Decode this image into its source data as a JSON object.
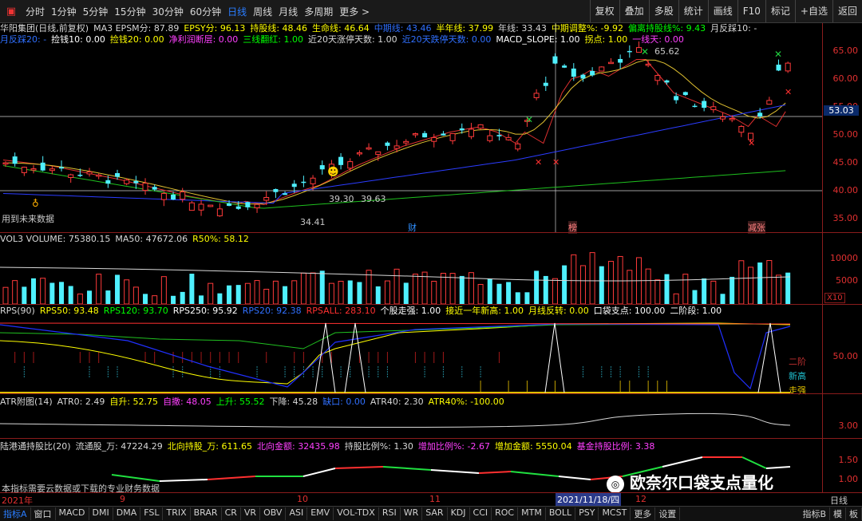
{
  "topbar": {
    "periods": [
      "分时",
      "1分钟",
      "5分钟",
      "15分钟",
      "30分钟",
      "60分钟",
      "日线",
      "周线",
      "月线",
      "多周期",
      "更多 >"
    ],
    "active_index": 6,
    "right_buttons": [
      "复权",
      "叠加",
      "多股",
      "统计",
      "画线",
      "F10",
      "标记",
      "+自选",
      "返回"
    ]
  },
  "main_info": {
    "row1": [
      {
        "t": "华阳集团(日线,前复权)",
        "c": "#d8d8d8"
      },
      {
        "t": "MA3 EPSM分: 87.89",
        "c": "#d8d8d8"
      },
      {
        "t": "EPSY分: 96.13",
        "c": "#ffff00"
      },
      {
        "t": "持股线: 48.46",
        "c": "#ffff00"
      },
      {
        "t": "生命线: 46.64",
        "c": "#ffff00"
      },
      {
        "t": "中期线: 43.46",
        "c": "#3070ff"
      },
      {
        "t": "半年线: 37.99",
        "c": "#ffff00"
      },
      {
        "t": "年线: 33.43",
        "c": "#d8d8d8"
      },
      {
        "t": "中期调整%: -9.92",
        "c": "#ffff00"
      },
      {
        "t": "偏离持股线%: 9.43",
        "c": "#00ff00"
      },
      {
        "t": "月反踩10: -",
        "c": "#d8d8d8"
      }
    ],
    "row2": [
      {
        "t": "月反踩20: -",
        "c": "#3070ff"
      },
      {
        "t": "捡钱10: 0.00",
        "c": "#ffffff"
      },
      {
        "t": "捡钱20: 0.00",
        "c": "#ffff00"
      },
      {
        "t": "净利润断层: 0.00",
        "c": "#ff40ff"
      },
      {
        "t": "三线翻红: 1.00",
        "c": "#00ff00"
      },
      {
        "t": "近20天涨停天数: 1.00",
        "c": "#d8d8d8"
      },
      {
        "t": "近20天跌停天数: 0.00",
        "c": "#3070ff"
      },
      {
        "t": "MACD_SLOPE: 1.00",
        "c": "#ffffff"
      },
      {
        "t": "拐点: 1.00",
        "c": "#ffff00"
      },
      {
        "t": "一线天: 0.00",
        "c": "#ff40ff"
      }
    ]
  },
  "main_axis": [
    "65.00",
    "60.00",
    "55.00",
    "50.00",
    "45.00",
    "40.00",
    "35.00"
  ],
  "current_price": "53.03",
  "main_notes": {
    "future": "用到未来数据",
    "low": "34.41",
    "p1": "39.30",
    "p2": "39.63",
    "high": "65.62",
    "tag1": "财",
    "tag2": "榜",
    "tag3": "减张"
  },
  "vol_info": [
    {
      "t": "VOL3 VOLUME: 75380.15",
      "c": "#d8d8d8"
    },
    {
      "t": "MA50: 47672.06",
      "c": "#d8d8d8"
    },
    {
      "t": "R50%: 58.12",
      "c": "#ffff00"
    }
  ],
  "vol_axis": [
    "10000",
    "5000"
  ],
  "vol_unit": "X10",
  "rps_info": [
    {
      "t": "RPS(90)",
      "c": "#d8d8d8"
    },
    {
      "t": "RPS50: 93.48",
      "c": "#ffff00"
    },
    {
      "t": "RPS120: 93.70",
      "c": "#00ff00"
    },
    {
      "t": "RPS250: 95.92",
      "c": "#ffffff"
    },
    {
      "t": "RPS20: 92.38",
      "c": "#3070ff"
    },
    {
      "t": "RPSALL: 283.10",
      "c": "#ff3030"
    },
    {
      "t": "个股走强: 1.00",
      "c": "#ffffff"
    },
    {
      "t": "接近一年新高: 1.00",
      "c": "#ffff00"
    },
    {
      "t": "月线反转: 0.00",
      "c": "#ffff00"
    },
    {
      "t": "口袋支点: 100.00",
      "c": "#ffffff"
    },
    {
      "t": "二阶段: 1.00",
      "c": "#ffffff"
    }
  ],
  "rps_axis": [
    "50.00"
  ],
  "rps_tags": [
    "二阶",
    "新高",
    "走强"
  ],
  "atr_info": [
    {
      "t": "ATR附图(14)",
      "c": "#d8d8d8"
    },
    {
      "t": "ATR0: 2.49",
      "c": "#d8d8d8"
    },
    {
      "t": "自升: 52.75",
      "c": "#ffff00"
    },
    {
      "t": "自撒: 48.05",
      "c": "#ff40ff"
    },
    {
      "t": "上升: 55.52",
      "c": "#00ff00"
    },
    {
      "t": "下降: 45.28",
      "c": "#d8d8d8"
    },
    {
      "t": "缺口: 0.00",
      "c": "#3070ff"
    },
    {
      "t": "ATR40: 2.30",
      "c": "#d8d8d8"
    },
    {
      "t": "ATR40%: -100.00",
      "c": "#ffff00"
    }
  ],
  "atr_axis": [
    "3.00"
  ],
  "hk_info": [
    {
      "t": "陆港通持股比(20)",
      "c": "#d8d8d8"
    },
    {
      "t": "流通股_万: 47224.29",
      "c": "#d8d8d8"
    },
    {
      "t": "北向持股_万: 611.65",
      "c": "#ffff00"
    },
    {
      "t": "北向金额: 32435.98",
      "c": "#ff40ff"
    },
    {
      "t": "持股比例%: 1.30",
      "c": "#d8d8d8"
    },
    {
      "t": "增加比例%: -2.67",
      "c": "#ff40ff"
    },
    {
      "t": "增加金额: 5550.04",
      "c": "#ffff00"
    },
    {
      "t": "基金持股比例: 3.38",
      "c": "#ff40ff"
    }
  ],
  "hk_axis": [
    "1.50",
    "1.00"
  ],
  "hk_note": "本指标需要云数据或下载的专业财务数据",
  "watermark": "欧奈尔口袋支点量化",
  "date_axis": {
    "year": "2021年",
    "m9": "9",
    "m10": "10",
    "m11": "11",
    "cursor": "2021/11/18/四",
    "m12": "12",
    "period": "日线"
  },
  "bottom_tabs": [
    "指标A",
    "窗口",
    "MACD",
    "DMI",
    "DMA",
    "FSL",
    "TRIX",
    "BRAR",
    "CR",
    "VR",
    "OBV",
    "ASI",
    "EMV",
    "VOL-TDX",
    "RSI",
    "WR",
    "SAR",
    "KDJ",
    "CCI",
    "ROC",
    "MTM",
    "BOLL",
    "PSY",
    "MCST",
    "更多",
    "设置"
  ],
  "bottom_right": [
    "指标B",
    "模",
    "板"
  ],
  "colors": {
    "up": "#ff3a3a",
    "down": "#4ff0ff",
    "ma_blue": "#2b3cff",
    "ma_green": "#1ec01e",
    "ma_yellow": "#e0c030",
    "ma_red": "#e03030"
  }
}
